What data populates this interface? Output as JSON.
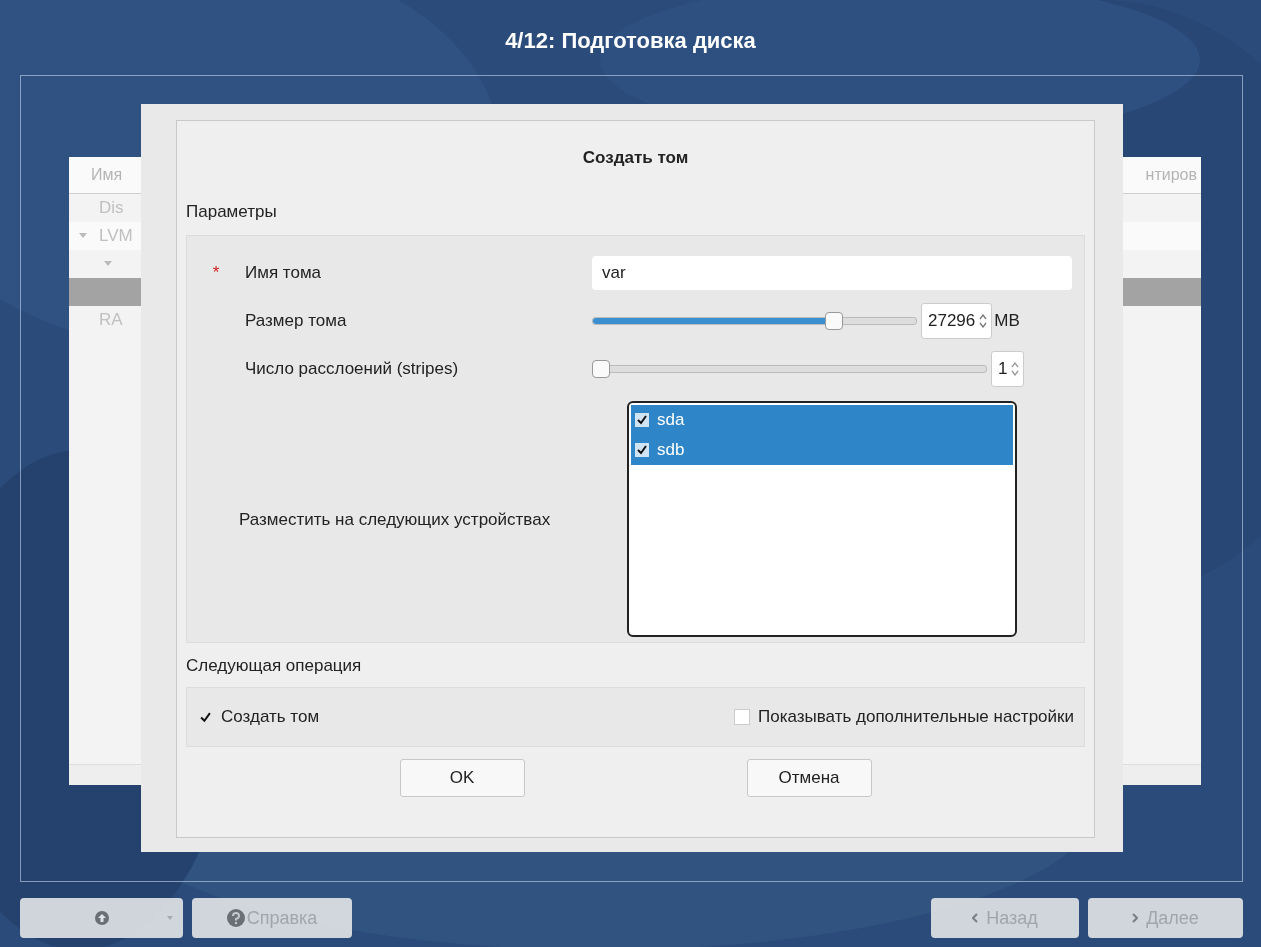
{
  "title": "4/12: Подготовка диска",
  "background_table": {
    "columns": [
      "Имя",
      "нтиров"
    ],
    "rows": [
      {
        "text": "Dis",
        "selected": false
      },
      {
        "text": "LVM",
        "expanded": true,
        "selected": false,
        "children": [
          {
            "expanded": true,
            "selected": false,
            "children": [
              {
                "selected": true
              }
            ]
          }
        ]
      },
      {
        "text": "RA",
        "selected": false
      }
    ]
  },
  "dialog": {
    "title": "Создать том",
    "parameters": {
      "heading": "Параметры",
      "required_mark": "*",
      "name_label": "Имя тома",
      "name_value": "var",
      "size_label": "Размер тома",
      "size_slider": {
        "level": 0.76
      },
      "size_value": "27296",
      "size_unit": "MB",
      "stripes_label": "Число расслоений (stripes)",
      "stripes_slider": {
        "level": 0
      },
      "stripes_value": "1",
      "devices_label": "Разместить на следующих устройствах",
      "devices": [
        {
          "name": "sda",
          "checked": true,
          "selected": true
        },
        {
          "name": "sdb",
          "checked": true,
          "selected": true
        }
      ]
    },
    "next_operation": {
      "heading": "Следующая операция",
      "options": [
        {
          "label": "Создать том",
          "checked": true
        },
        {
          "label": "Показывать дополнительные настройки",
          "checked": false
        }
      ]
    },
    "buttons": [
      "OK",
      "Отмена"
    ]
  },
  "nav": [
    {
      "kind": "up",
      "disabled": true
    },
    {
      "kind": "help",
      "label": "Справка",
      "disabled": true
    },
    {
      "kind": "back",
      "label": "Назад",
      "disabled": true
    },
    {
      "kind": "next",
      "label": "Далее",
      "disabled": true
    }
  ]
}
